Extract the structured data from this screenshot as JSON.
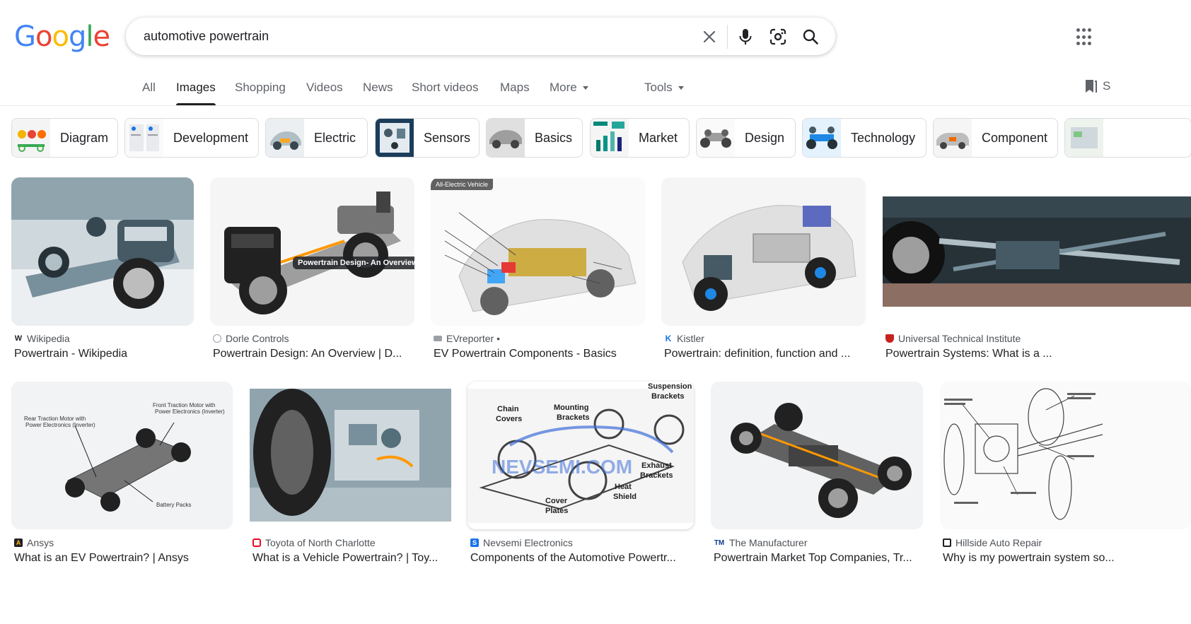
{
  "colors": {
    "blue": "#4285F4",
    "red": "#EA4335",
    "yellow": "#FBBC05",
    "green": "#34A853",
    "text": "#202124",
    "muted": "#5f6368"
  },
  "logo": {
    "g1": "G",
    "o1": "o",
    "o2": "o",
    "g2": "g",
    "l": "l",
    "e": "e"
  },
  "search": {
    "query": "automotive powertrain"
  },
  "tabs": [
    {
      "label": "All"
    },
    {
      "label": "Images"
    },
    {
      "label": "Shopping"
    },
    {
      "label": "Videos"
    },
    {
      "label": "News"
    },
    {
      "label": "Short videos"
    },
    {
      "label": "Maps"
    },
    {
      "label": "More"
    },
    {
      "label": "Tools"
    }
  ],
  "saved_label": "S",
  "chips": [
    {
      "label": "Diagram"
    },
    {
      "label": "Development"
    },
    {
      "label": "Electric"
    },
    {
      "label": "Sensors"
    },
    {
      "label": "Basics"
    },
    {
      "label": "Market"
    },
    {
      "label": "Design"
    },
    {
      "label": "Technology"
    },
    {
      "label": "Component"
    }
  ],
  "results": [
    {
      "source": "Wikipedia",
      "title": "Powertrain - Wikipedia",
      "favicon": "W",
      "favicon_color": "#ffffff"
    },
    {
      "source": "Dorle Controls",
      "title": "Powertrain Design: An Overview | D...",
      "favicon": "",
      "favicon_color": "#ffffff",
      "overlay": "Powertrain Design- An Overview"
    },
    {
      "source": "EVreporter •",
      "title": "EV Powertrain Components - Basics",
      "favicon": "",
      "favicon_color": "#9aa0a6",
      "badge": "All-Electric Vehicle"
    },
    {
      "source": "Kistler",
      "title": "Powertrain: definition, function and ...",
      "favicon": "K",
      "favicon_color": "#1a73e8"
    },
    {
      "source": "Universal Technical Institute",
      "title": "Powertrain Systems: What is a ...",
      "favicon": "",
      "favicon_color": "#c5221f"
    },
    {
      "source": "Ansys",
      "title": "What is an EV Powertrain? | Ansys",
      "favicon": "A",
      "favicon_color": "#202124",
      "labels": [
        "Rear Traction Motor with",
        "Power Electronics (Inverter)",
        "Front Traction Motor with",
        "Power Electronics (Inverter)",
        "Battery Packs"
      ]
    },
    {
      "source": "Toyota of North Charlotte",
      "title": "What is a Vehicle Powertrain? | Toy...",
      "favicon": "",
      "favicon_color": "#eb0a1e"
    },
    {
      "source": "Nevsemi Electronics",
      "title": "Components of the Automotive Powertr...",
      "favicon": "",
      "favicon_color": "#1a73e8",
      "labels": [
        "Suspension",
        "Brackets",
        "Chain",
        "Covers",
        "Mounting",
        "Brackets",
        "Exhaust",
        "Brackets",
        "Heat",
        "Shield",
        "Cover",
        "Plates"
      ],
      "watermark": "NEVSEMI.COM"
    },
    {
      "source": "The Manufacturer",
      "title": "Powertrain Market Top Companies, Tr...",
      "favicon": "TM",
      "favicon_color": "#0b3d91"
    },
    {
      "source": "Hillside Auto Repair",
      "title": "Why is my powertrain system so...",
      "favicon": "",
      "favicon_color": "#202124"
    }
  ]
}
